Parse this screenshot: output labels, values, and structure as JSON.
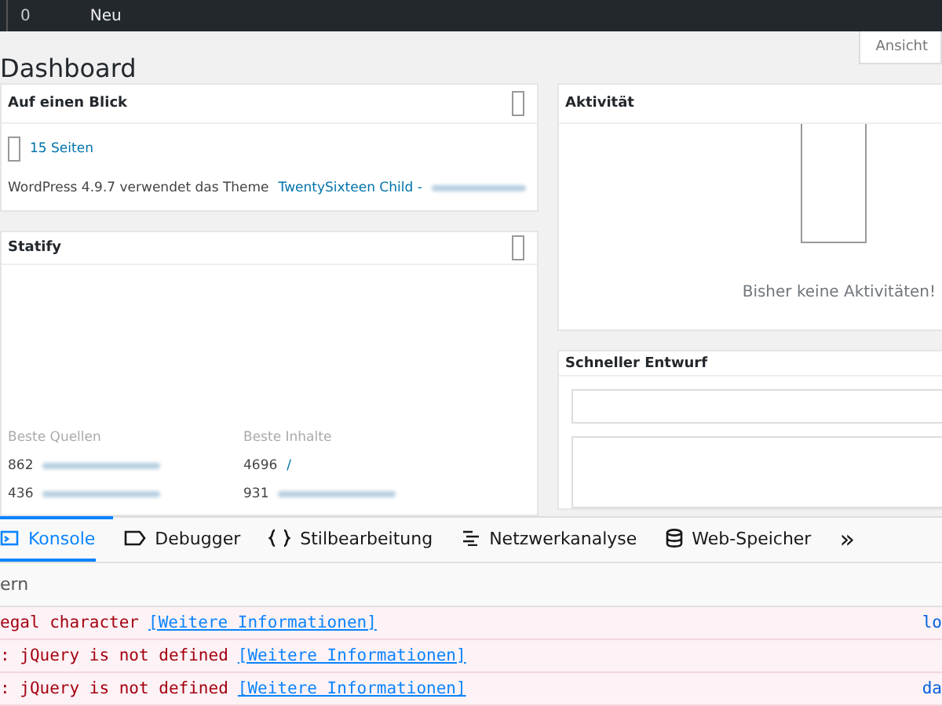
{
  "admin_bar": {
    "comments_count": "0",
    "new_label": "Neu"
  },
  "screen_options": "Ansicht",
  "page_title": "Dashboard",
  "widgets_left": [
    {
      "title": "Auf einen Blick",
      "kind": "glance",
      "pages_link": "15 Seiten",
      "theme_text": "WordPress 4.9.7 verwendet das Theme",
      "theme_link": "TwentySixteen Child -"
    },
    {
      "title": "Statify",
      "kind": "stats",
      "columns": [
        {
          "heading": "Beste Quellen",
          "rows": [
            {
              "count": "862"
            },
            {
              "count": "436"
            }
          ]
        },
        {
          "heading": "Beste Inhalte",
          "rows": [
            {
              "count": "4696",
              "link": "/"
            },
            {
              "count": "931"
            }
          ]
        }
      ]
    }
  ],
  "widgets_right": [
    {
      "title": "Aktivität",
      "kind": "activity",
      "empty_text": "Bisher keine Aktivitäten!"
    },
    {
      "title": "Schneller Entwurf",
      "kind": "draft"
    }
  ],
  "devtools": {
    "tabs": [
      {
        "label": "Konsole",
        "kind": "console",
        "selected": true
      },
      {
        "label": "Debugger",
        "kind": "debugger",
        "selected": false
      },
      {
        "label": "Stilbearbeitung",
        "kind": "braces",
        "selected": false
      },
      {
        "label": "Netzwerkanalyse",
        "kind": "network",
        "selected": false
      },
      {
        "label": "Web-Speicher",
        "kind": "storage",
        "selected": false
      }
    ],
    "overflow": "»",
    "load_progress": {
      "level": 0.12
    },
    "filter_text": "ern",
    "messages": [
      {
        "text": "egal character",
        "link": "[Weitere Informationen]",
        "source": "lo"
      },
      {
        "text": ": jQuery is not defined",
        "link": "[Weitere Informationen]"
      },
      {
        "text": ": jQuery is not defined",
        "link": "[Weitere Informationen]",
        "source": "da"
      }
    ]
  }
}
